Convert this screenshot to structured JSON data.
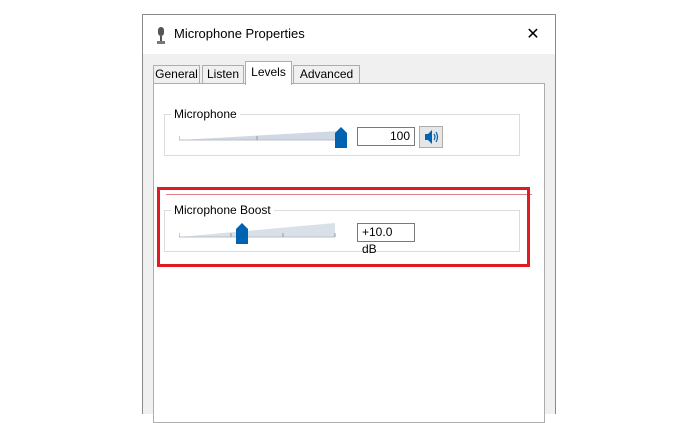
{
  "window": {
    "title": "Microphone Properties",
    "close_glyph": "✕",
    "title_icon": "microphone-icon"
  },
  "tabs": [
    {
      "label": "General",
      "selected": false
    },
    {
      "label": "Listen",
      "selected": false
    },
    {
      "label": "Levels",
      "selected": true
    },
    {
      "label": "Advanced",
      "selected": false
    }
  ],
  "levels": {
    "microphone": {
      "label": "Microphone",
      "value": "100",
      "level": 1.0,
      "speaker_icon": "speaker-icon"
    },
    "boost": {
      "label": "Microphone Boost",
      "value": "+10.0 dB",
      "level": 0.333
    }
  },
  "colors": {
    "accent": "#0063b1",
    "highlight": "#e01b24",
    "dialog_bg": "#f0f0f0"
  }
}
